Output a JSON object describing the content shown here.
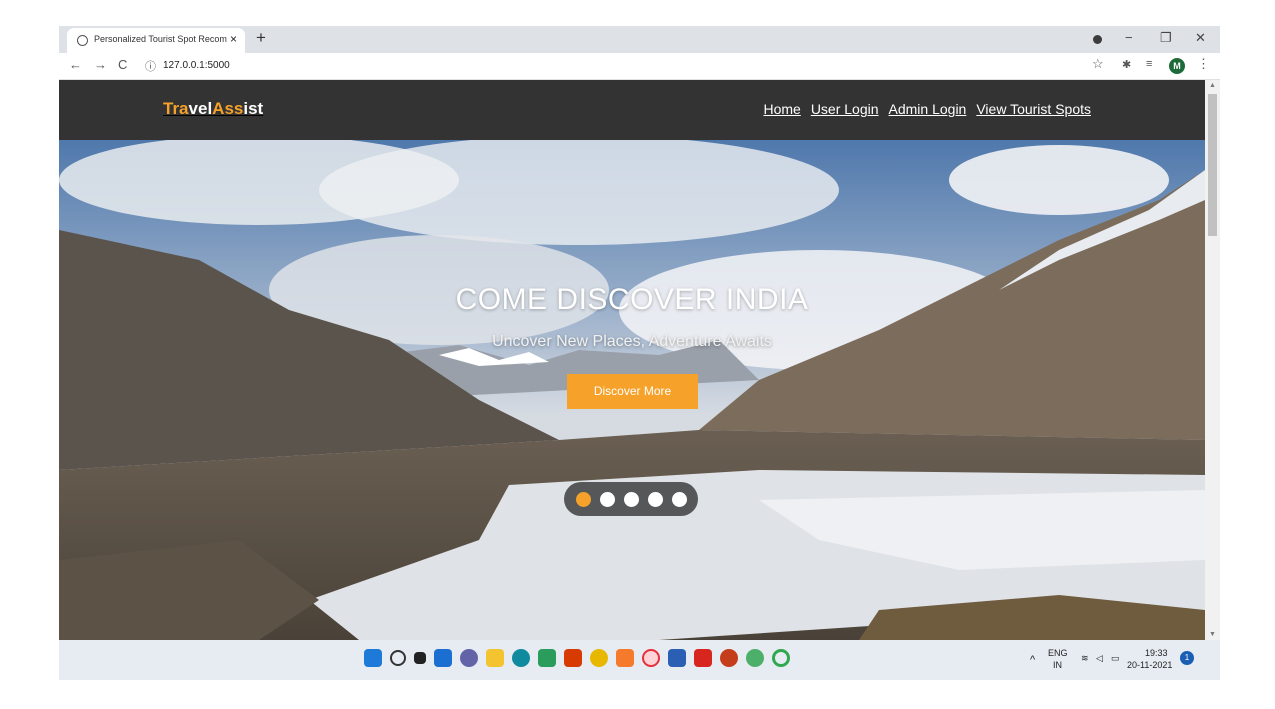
{
  "browser": {
    "tab_title": "Personalized Tourist Spot Recomm",
    "tab_close": "×",
    "new_tab": "+",
    "url": "127.0.0.1:5000",
    "back": "←",
    "forward": "→",
    "reload": "C",
    "info": "ⓘ",
    "star": "☆",
    "extensions": "✱",
    "reading_list": "≡",
    "profile_initial": "M",
    "menu": "⋮",
    "minimize": "−",
    "restore": "❐",
    "close": "✕"
  },
  "site": {
    "logo_parts": [
      "Tra",
      "vel",
      "Ass",
      "ist"
    ],
    "nav": [
      "Home",
      "User Login",
      "Admin Login",
      "View Tourist Spots"
    ]
  },
  "hero": {
    "title": "COME DISCOVER INDIA",
    "subtitle": "Uncover New Places, Adventure Awaits",
    "button": "Discover More",
    "slides": 5,
    "active_slide": 1
  },
  "taskbar": {
    "lang_top": "ENG",
    "lang_bottom": "IN",
    "time": "19:33",
    "date": "20-11-2021",
    "notifications": "1",
    "tray_chevron": "^",
    "icons": [
      "windows-start-icon",
      "search-icon",
      "task-view-icon",
      "widgets-icon",
      "teams-chat-icon",
      "file-explorer-icon",
      "edge-icon",
      "l-app-icon",
      "office-icon",
      "chrome-icon",
      "xampp-icon",
      "opera-icon",
      "word-icon",
      "acrobat-icon",
      "powerpoint-icon",
      "globe-app-icon",
      "circle-app-icon"
    ]
  },
  "colors": {
    "accent": "#f5a12a",
    "navbar": "#333333"
  }
}
